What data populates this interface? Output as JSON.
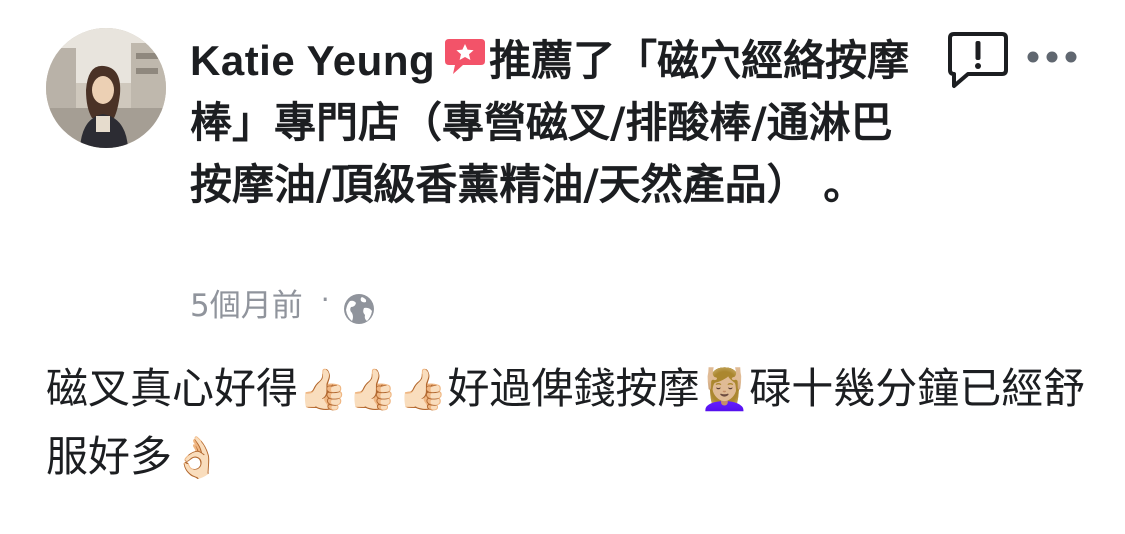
{
  "post": {
    "author": "Katie Yeung",
    "recommendation_text": "推薦了「磁穴經絡按摩棒」專門店（專營磁叉/排酸棒/通淋巴按摩油/頂級香薰精油/天然產品） 。",
    "time": "5個月前",
    "separator": "·",
    "body_part1": "磁叉真心好得",
    "emoji_thumbs": "👍🏻👍🏻👍🏻",
    "body_part2": "好過俾錢按摩",
    "emoji_massage": "💆🏼‍♀️",
    "body_part3": "碌十幾分鐘已經舒服好多",
    "emoji_ok": "👌🏻"
  },
  "icons": {
    "recommend": "recommend-badge-icon",
    "globe": "globe-icon",
    "report": "report-icon",
    "more": "more-icon"
  },
  "colors": {
    "recommend_badge": "#f35369",
    "text": "#1c1e21",
    "meta": "#90949c"
  }
}
